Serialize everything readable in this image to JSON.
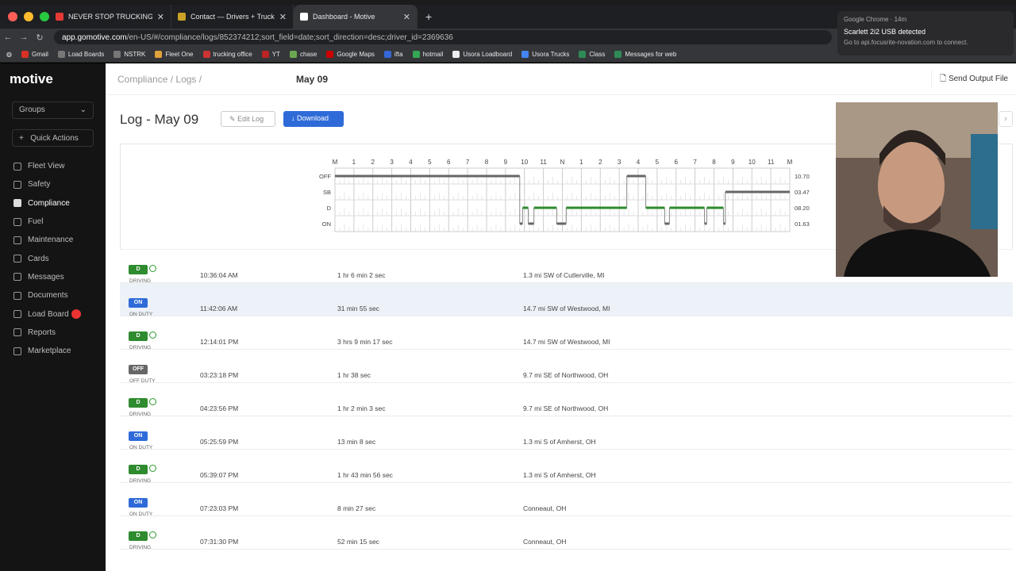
{
  "browser": {
    "tabs": [
      {
        "title": "NEVER STOP TRUCKING",
        "favicon_color": "#e53935"
      },
      {
        "title": "Contact — Drivers + Trucking",
        "favicon_color": "#c9a227"
      },
      {
        "title": "Dashboard - Motive",
        "favicon_color": "#ffffff"
      }
    ],
    "url_host": "app.gomotive.com",
    "url_path": "/en-US/#/compliance/logs/852374212;sort_field=date;sort_direction=desc;driver_id=2369636",
    "bookmarks": [
      "Gmail",
      "Load Boards",
      "NSTRK",
      "Fleet One",
      "trucking office",
      "YT",
      "chase",
      "Google Maps",
      "ifta",
      "hotmail",
      "Usora Loadboard",
      "Usora Trucks",
      "Class",
      "Messages for web"
    ]
  },
  "notification": {
    "app": "Google Chrome · 14m",
    "title": "Scarlett 2i2 USB detected",
    "body": "Go to api.focusrite-novation.com to connect."
  },
  "sidebar": {
    "logo": "motive",
    "groups": "Groups",
    "quick_actions": "Quick Actions",
    "items": [
      {
        "label": "Fleet View"
      },
      {
        "label": "Safety"
      },
      {
        "label": "Compliance",
        "active": true
      },
      {
        "label": "Fuel"
      },
      {
        "label": "Maintenance"
      },
      {
        "label": "Cards"
      },
      {
        "label": "Messages"
      },
      {
        "label": "Documents"
      },
      {
        "label": "Load Board",
        "alert": true
      },
      {
        "label": "Reports"
      },
      {
        "label": "Marketplace"
      }
    ]
  },
  "header": {
    "crumb_compliance": "Compliance",
    "crumb_logs": "Logs",
    "crumb_current": "May 09",
    "send_output": "Send Output File"
  },
  "log": {
    "title": "Log - May 09",
    "edit": "Edit Log",
    "download": "Download"
  },
  "graph": {
    "hours": [
      "M",
      "1",
      "2",
      "3",
      "4",
      "5",
      "6",
      "7",
      "8",
      "9",
      "10",
      "11",
      "N",
      "1",
      "2",
      "3",
      "4",
      "5",
      "6",
      "7",
      "8",
      "9",
      "10",
      "11",
      "M"
    ],
    "statuses": [
      "OFF",
      "SB",
      "D",
      "ON"
    ],
    "totals": [
      "10.70",
      "03.47",
      "08.20",
      "01.63"
    ],
    "segments": [
      {
        "status": "OFF",
        "start": 0,
        "end": 9.75
      },
      {
        "status": "ON",
        "start": 9.75,
        "end": 9.9
      },
      {
        "status": "D",
        "start": 9.9,
        "end": 10.2
      },
      {
        "status": "ON",
        "start": 10.2,
        "end": 10.5
      },
      {
        "status": "D",
        "start": 10.5,
        "end": 11.7
      },
      {
        "status": "ON",
        "start": 11.7,
        "end": 12.2
      },
      {
        "status": "D",
        "start": 12.2,
        "end": 15.4
      },
      {
        "status": "OFF",
        "start": 15.4,
        "end": 16.4
      },
      {
        "status": "D",
        "start": 16.4,
        "end": 17.4
      },
      {
        "status": "ON",
        "start": 17.4,
        "end": 17.65
      },
      {
        "status": "D",
        "start": 17.65,
        "end": 19.5
      },
      {
        "status": "ON",
        "start": 19.5,
        "end": 19.62
      },
      {
        "status": "D",
        "start": 19.62,
        "end": 20.5
      },
      {
        "status": "ON",
        "start": 20.5,
        "end": 20.6
      },
      {
        "status": "SB",
        "start": 20.6,
        "end": 24
      }
    ]
  },
  "rows": [
    {
      "badge": "D",
      "status": "DRIVING",
      "time": "10:36:04 AM",
      "duration": "1 hr 6 min 2 sec",
      "location": "1.3 mi SW of Cutlerville, MI"
    },
    {
      "badge": "ON",
      "status": "ON DUTY",
      "time": "11:42:06 AM",
      "duration": "31 min 55 sec",
      "location": "14.7 mi SW of Westwood, MI",
      "highlight": true
    },
    {
      "badge": "D",
      "status": "DRIVING",
      "time": "12:14:01 PM",
      "duration": "3 hrs 9 min 17 sec",
      "location": "14.7 mi SW of Westwood, MI"
    },
    {
      "badge": "OFF",
      "status": "OFF DUTY",
      "time": "03:23:18 PM",
      "duration": "1 hr 38 sec",
      "location": "9.7 mi SE of Northwood, OH"
    },
    {
      "badge": "D",
      "status": "DRIVING",
      "time": "04:23:56 PM",
      "duration": "1 hr 2 min 3 sec",
      "location": "9.7 mi SE of Northwood, OH"
    },
    {
      "badge": "ON",
      "status": "ON DUTY",
      "time": "05:25:59 PM",
      "duration": "13 min 8 sec",
      "location": "1.3 mi S of Amherst, OH"
    },
    {
      "badge": "D",
      "status": "DRIVING",
      "time": "05:39:07 PM",
      "duration": "1 hr 43 min 56 sec",
      "location": "1.3 mi S of Amherst, OH"
    },
    {
      "badge": "ON",
      "status": "ON DUTY",
      "time": "07:23:03 PM",
      "duration": "8 min 27 sec",
      "location": "Conneaut, OH"
    },
    {
      "badge": "D",
      "status": "DRIVING",
      "time": "07:31:30 PM",
      "duration": "52 min 15 sec",
      "location": "Conneaut, OH"
    }
  ],
  "colors": {
    "driving": "#2e8b2e",
    "on_duty": "#2f6bd8",
    "off_duty": "#666666",
    "accent": "#2f6bd8"
  }
}
